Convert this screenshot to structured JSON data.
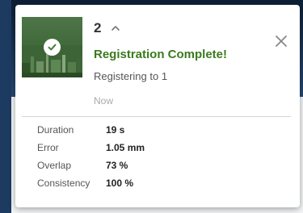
{
  "notification": {
    "count": "2",
    "title": "Registration Complete!",
    "subtitle": "Registering to 1",
    "time": "Now",
    "accent_color": "#3a7a1e",
    "status_icon": "check-circle-icon",
    "expand_icon": "chevron-up-icon",
    "close_icon": "close-icon"
  },
  "stats": [
    {
      "label": "Duration",
      "value": "19 s"
    },
    {
      "label": "Error",
      "value": "1.05 mm"
    },
    {
      "label": "Overlap",
      "value": "73 %"
    },
    {
      "label": "Consistency",
      "value": "100 %"
    }
  ]
}
